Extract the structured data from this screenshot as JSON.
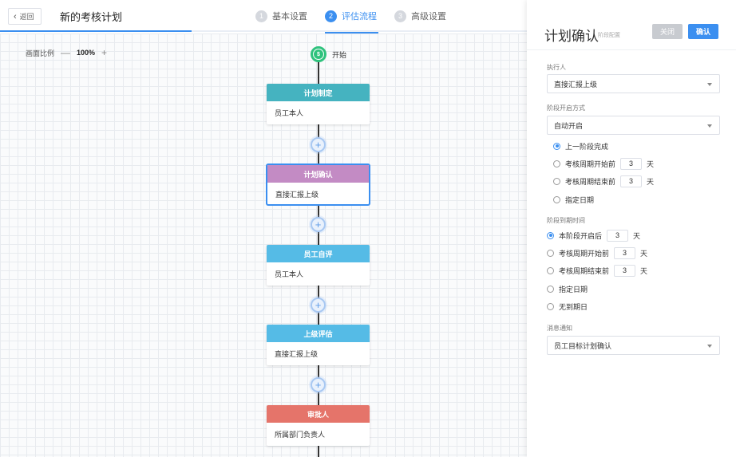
{
  "header": {
    "back_label": "返回",
    "title": "新的考核计划",
    "steps": [
      {
        "num": "1",
        "label": "基本设置"
      },
      {
        "num": "2",
        "label": "评估流程"
      },
      {
        "num": "3",
        "label": "高级设置"
      }
    ],
    "active_step": 2
  },
  "canvas": {
    "zoom_label": "画面比例",
    "zoom_minus": "—",
    "zoom_value": "100%",
    "zoom_plus": "+",
    "start_icon": "$",
    "start_label": "开始",
    "add_symbol": "+",
    "nodes": [
      {
        "title": "计划制定",
        "body": "员工本人",
        "color": "#45b3c0",
        "selected": false
      },
      {
        "title": "计划确认",
        "body": "直接汇报上级",
        "color": "#c38bc4",
        "selected": true
      },
      {
        "title": "员工自评",
        "body": "员工本人",
        "color": "#55bbe6",
        "selected": false
      },
      {
        "title": "上级评估",
        "body": "直接汇报上级",
        "color": "#55bbe6",
        "selected": false
      },
      {
        "title": "审批人",
        "body": "所属部门负责人",
        "color": "#e5746a",
        "selected": false
      }
    ]
  },
  "panel": {
    "title": "计划确认",
    "subtitle": "阶段配置",
    "close_label": "关闭",
    "confirm_label": "确认",
    "executor_label": "执行人",
    "executor_value": "直接汇报上级",
    "start_mode_label": "阶段开启方式",
    "start_mode_value": "自动开启",
    "start_options": [
      {
        "label": "上一阶段完成",
        "checked": true
      },
      {
        "label": "考核周期开始前",
        "value": "3",
        "unit": "天",
        "checked": false
      },
      {
        "label": "考核周期结束前",
        "value": "3",
        "unit": "天",
        "checked": false
      },
      {
        "label": "指定日期",
        "checked": false
      }
    ],
    "due_label": "阶段到期时间",
    "due_options": [
      {
        "label": "本阶段开启后",
        "value": "3",
        "unit": "天",
        "checked": true
      },
      {
        "label": "考核周期开始前",
        "value": "3",
        "unit": "天",
        "checked": false
      },
      {
        "label": "考核周期结束前",
        "value": "3",
        "unit": "天",
        "checked": false
      },
      {
        "label": "指定日期",
        "checked": false
      },
      {
        "label": "无到期日",
        "checked": false
      }
    ],
    "notify_label": "消息通知",
    "notify_value": "员工目标计划确认"
  },
  "colors": {
    "accent": "#3b8ff0",
    "start_green": "#2fc27d"
  }
}
